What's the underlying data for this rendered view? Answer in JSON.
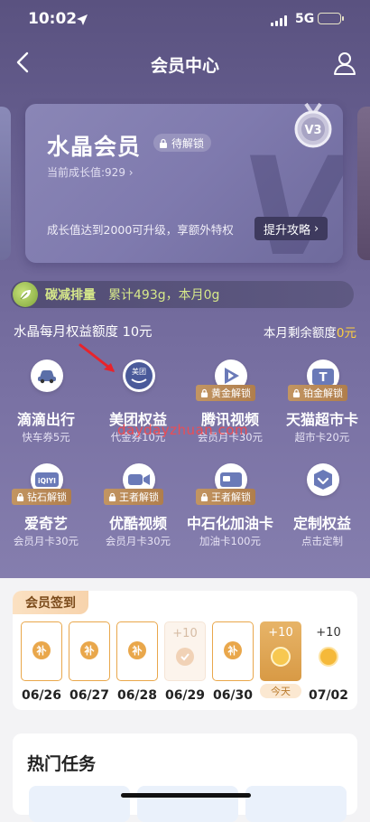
{
  "status": {
    "time": "10:02",
    "network": "5G"
  },
  "nav": {
    "title": "会员中心"
  },
  "card": {
    "title": "水晶会员",
    "lock_label": "待解锁",
    "growth": "当前成长值:929",
    "upgrade_note": "成长值达到2000可升级，享额外特权",
    "strategy_label": "提升攻略",
    "medal_text": "V3"
  },
  "carbon": {
    "label": "碳减排量",
    "value": "累计493g，本月0g"
  },
  "quota": {
    "title": "水晶每月权益额度 10元",
    "remaining_label": "本月剩余额度",
    "remaining_value": "0元"
  },
  "benefits": [
    {
      "name": "滴滴出行",
      "sub": "快车券5元",
      "badge": "",
      "icon": "car-icon"
    },
    {
      "name": "美团权益",
      "sub": "代金券10元",
      "badge": "",
      "icon": "meituan-icon",
      "icon_text": "美团"
    },
    {
      "name": "腾讯视频",
      "sub": "会员月卡30元",
      "badge": "黄金解锁",
      "icon": "video-play-icon"
    },
    {
      "name": "天猫超市卡",
      "sub": "超市卡20元",
      "badge": "铂金解锁",
      "icon": "tmall-icon",
      "icon_text": "T"
    },
    {
      "name": "爱奇艺",
      "sub": "会员月卡30元",
      "badge": "钻石解锁",
      "icon": "iqiyi-icon",
      "icon_text": "iQIYI"
    },
    {
      "name": "优酷视频",
      "sub": "会员月卡30元",
      "badge": "王者解锁",
      "icon": "youku-icon"
    },
    {
      "name": "中石化加油卡",
      "sub": "加油卡100元",
      "badge": "王者解锁",
      "icon": "fuel-card-icon"
    },
    {
      "name": "定制权益",
      "sub": "点击定制",
      "badge": "",
      "icon": "custom-benefit-icon"
    }
  ],
  "watermark": "daydayzhuan.com",
  "checkin": {
    "title": "会员签到",
    "coin_text": "补",
    "days": [
      {
        "date": "06/26",
        "state": "makeup",
        "points": ""
      },
      {
        "date": "06/27",
        "state": "makeup",
        "points": ""
      },
      {
        "date": "06/28",
        "state": "makeup",
        "points": ""
      },
      {
        "date": "06/29",
        "state": "signed",
        "points": "+10"
      },
      {
        "date": "06/30",
        "state": "makeup",
        "points": ""
      },
      {
        "date": "",
        "state": "today",
        "points": "+10",
        "label": "今天"
      },
      {
        "date": "07/02",
        "state": "future",
        "points": "+10"
      }
    ]
  },
  "tasks": {
    "title": "热门任务"
  },
  "colors": {
    "accent_gold": "#e9a74b",
    "quota_highlight": "#ffcf3e",
    "top_bg": "#6a6294"
  }
}
